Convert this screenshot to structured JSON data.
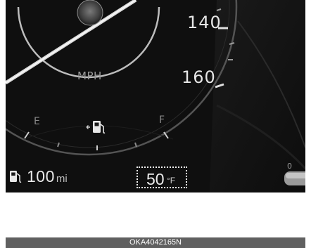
{
  "speedometer": {
    "tick_140": "140",
    "tick_160": "160",
    "unit": "MPH"
  },
  "fuel_gauge": {
    "empty_label": "E",
    "full_label": "F",
    "icon": "fuel-pump-icon"
  },
  "trip_info": {
    "range_value": "100",
    "range_unit": "mi",
    "range_icon": "fuel-pump-icon",
    "outside_temp_value": "50",
    "outside_temp_unit": "°F",
    "side_gauge_tick": "0"
  },
  "caption": "OKA4042165N",
  "colors": {
    "panel_background": "#0f0f0f",
    "caption_bar": "#606060",
    "highlight_box": "#f2f2f2"
  }
}
